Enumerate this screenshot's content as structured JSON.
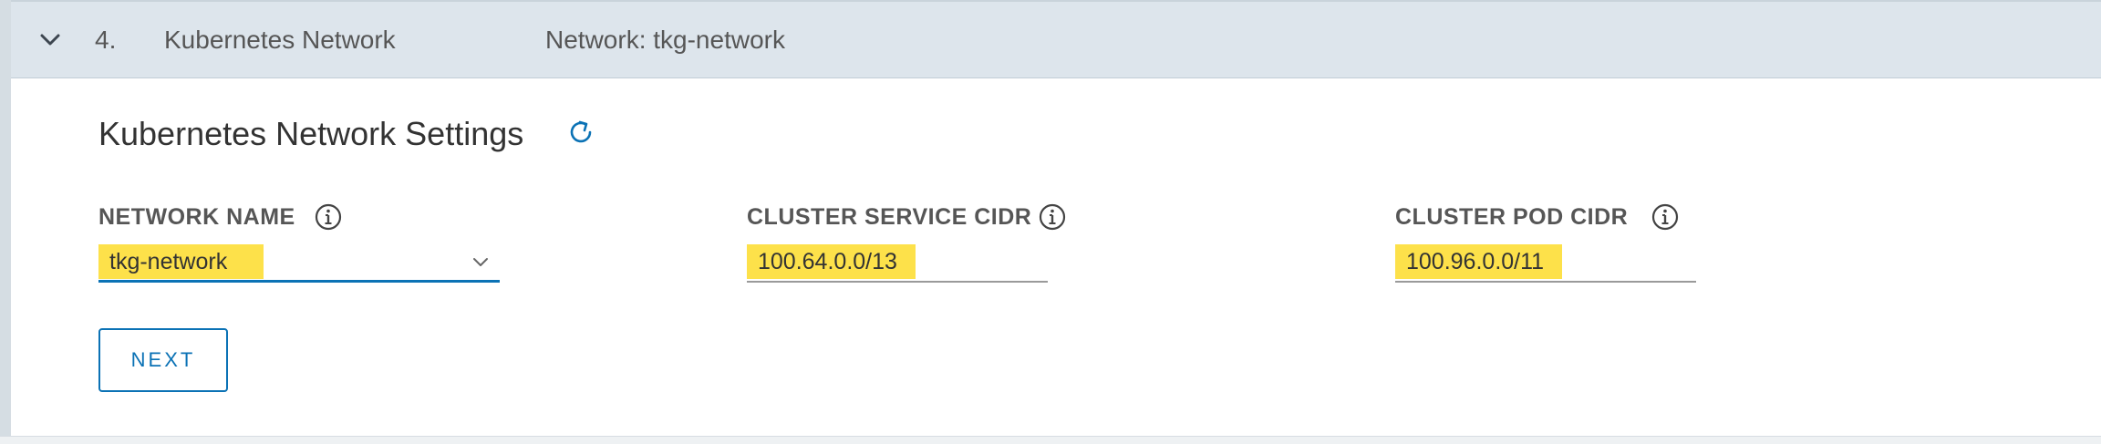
{
  "step": {
    "number": "4.",
    "title": "Kubernetes Network",
    "summary": "Network: tkg-network",
    "expanded_icon": "chevron-down-icon"
  },
  "section": {
    "title": "Kubernetes Network Settings",
    "refresh_icon": "refresh-icon"
  },
  "fields": {
    "network_name": {
      "label": "NETWORK NAME",
      "value": "tkg-network",
      "type": "select"
    },
    "cluster_service_cidr": {
      "label": "CLUSTER SERVICE CIDR",
      "value": "100.64.0.0/13"
    },
    "cluster_pod_cidr": {
      "label": "CLUSTER POD CIDR",
      "value": "100.96.0.0/11"
    }
  },
  "next_button": {
    "label": "NEXT"
  },
  "colors": {
    "header_bg": "#dde5ec",
    "accent": "#0b72b5",
    "highlight": "#fde14a",
    "label_text": "#565656"
  }
}
